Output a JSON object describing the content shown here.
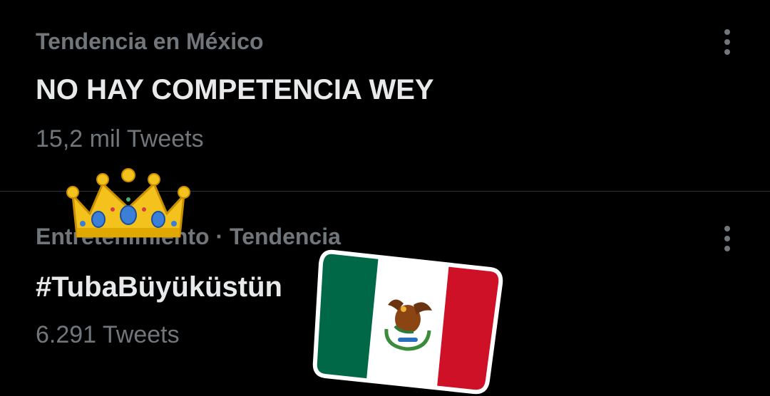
{
  "trends": [
    {
      "context": "Tendencia en México",
      "name": "NO HAY COMPETENCIA WEY",
      "count": "15,2 mil Tweets",
      "more_icon": "more-vertical-icon"
    },
    {
      "category": "Entretenimiento",
      "separator": "·",
      "label": "Tendencia",
      "name": "#TubaBüyüküstün",
      "count": "6.291 Tweets",
      "more_icon": "more-vertical-icon"
    }
  ],
  "stickers": {
    "crown": "crown-emoji",
    "flag": "mexico-flag-emoji"
  },
  "colors": {
    "background": "#000000",
    "primary_text": "#e7e9ea",
    "secondary_text": "#71767b",
    "divider": "#2f3336",
    "flag_green": "#006847",
    "flag_white": "#ffffff",
    "flag_red": "#ce1126",
    "crown_gold": "#f4c21c",
    "crown_gem": "#3b7fd6"
  }
}
